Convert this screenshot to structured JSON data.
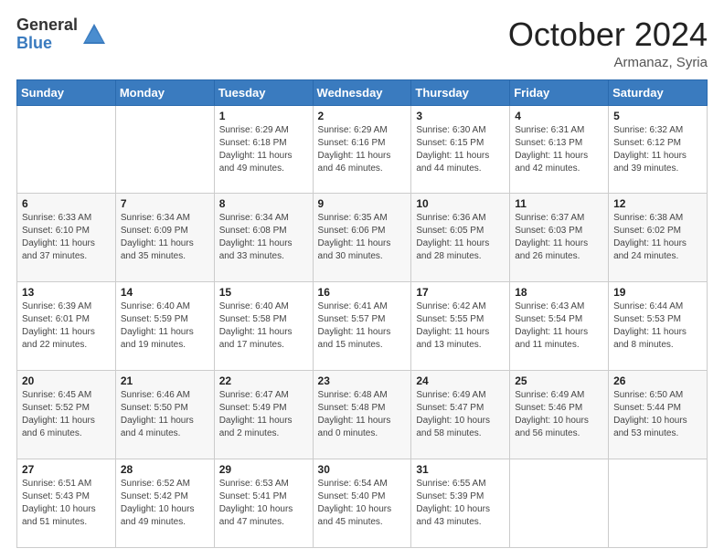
{
  "header": {
    "logo_general": "General",
    "logo_blue": "Blue",
    "month_title": "October 2024",
    "location": "Armanaz, Syria"
  },
  "weekdays": [
    "Sunday",
    "Monday",
    "Tuesday",
    "Wednesday",
    "Thursday",
    "Friday",
    "Saturday"
  ],
  "weeks": [
    [
      {
        "day": "",
        "detail": ""
      },
      {
        "day": "",
        "detail": ""
      },
      {
        "day": "1",
        "detail": "Sunrise: 6:29 AM\nSunset: 6:18 PM\nDaylight: 11 hours and 49 minutes."
      },
      {
        "day": "2",
        "detail": "Sunrise: 6:29 AM\nSunset: 6:16 PM\nDaylight: 11 hours and 46 minutes."
      },
      {
        "day": "3",
        "detail": "Sunrise: 6:30 AM\nSunset: 6:15 PM\nDaylight: 11 hours and 44 minutes."
      },
      {
        "day": "4",
        "detail": "Sunrise: 6:31 AM\nSunset: 6:13 PM\nDaylight: 11 hours and 42 minutes."
      },
      {
        "day": "5",
        "detail": "Sunrise: 6:32 AM\nSunset: 6:12 PM\nDaylight: 11 hours and 39 minutes."
      }
    ],
    [
      {
        "day": "6",
        "detail": "Sunrise: 6:33 AM\nSunset: 6:10 PM\nDaylight: 11 hours and 37 minutes."
      },
      {
        "day": "7",
        "detail": "Sunrise: 6:34 AM\nSunset: 6:09 PM\nDaylight: 11 hours and 35 minutes."
      },
      {
        "day": "8",
        "detail": "Sunrise: 6:34 AM\nSunset: 6:08 PM\nDaylight: 11 hours and 33 minutes."
      },
      {
        "day": "9",
        "detail": "Sunrise: 6:35 AM\nSunset: 6:06 PM\nDaylight: 11 hours and 30 minutes."
      },
      {
        "day": "10",
        "detail": "Sunrise: 6:36 AM\nSunset: 6:05 PM\nDaylight: 11 hours and 28 minutes."
      },
      {
        "day": "11",
        "detail": "Sunrise: 6:37 AM\nSunset: 6:03 PM\nDaylight: 11 hours and 26 minutes."
      },
      {
        "day": "12",
        "detail": "Sunrise: 6:38 AM\nSunset: 6:02 PM\nDaylight: 11 hours and 24 minutes."
      }
    ],
    [
      {
        "day": "13",
        "detail": "Sunrise: 6:39 AM\nSunset: 6:01 PM\nDaylight: 11 hours and 22 minutes."
      },
      {
        "day": "14",
        "detail": "Sunrise: 6:40 AM\nSunset: 5:59 PM\nDaylight: 11 hours and 19 minutes."
      },
      {
        "day": "15",
        "detail": "Sunrise: 6:40 AM\nSunset: 5:58 PM\nDaylight: 11 hours and 17 minutes."
      },
      {
        "day": "16",
        "detail": "Sunrise: 6:41 AM\nSunset: 5:57 PM\nDaylight: 11 hours and 15 minutes."
      },
      {
        "day": "17",
        "detail": "Sunrise: 6:42 AM\nSunset: 5:55 PM\nDaylight: 11 hours and 13 minutes."
      },
      {
        "day": "18",
        "detail": "Sunrise: 6:43 AM\nSunset: 5:54 PM\nDaylight: 11 hours and 11 minutes."
      },
      {
        "day": "19",
        "detail": "Sunrise: 6:44 AM\nSunset: 5:53 PM\nDaylight: 11 hours and 8 minutes."
      }
    ],
    [
      {
        "day": "20",
        "detail": "Sunrise: 6:45 AM\nSunset: 5:52 PM\nDaylight: 11 hours and 6 minutes."
      },
      {
        "day": "21",
        "detail": "Sunrise: 6:46 AM\nSunset: 5:50 PM\nDaylight: 11 hours and 4 minutes."
      },
      {
        "day": "22",
        "detail": "Sunrise: 6:47 AM\nSunset: 5:49 PM\nDaylight: 11 hours and 2 minutes."
      },
      {
        "day": "23",
        "detail": "Sunrise: 6:48 AM\nSunset: 5:48 PM\nDaylight: 11 hours and 0 minutes."
      },
      {
        "day": "24",
        "detail": "Sunrise: 6:49 AM\nSunset: 5:47 PM\nDaylight: 10 hours and 58 minutes."
      },
      {
        "day": "25",
        "detail": "Sunrise: 6:49 AM\nSunset: 5:46 PM\nDaylight: 10 hours and 56 minutes."
      },
      {
        "day": "26",
        "detail": "Sunrise: 6:50 AM\nSunset: 5:44 PM\nDaylight: 10 hours and 53 minutes."
      }
    ],
    [
      {
        "day": "27",
        "detail": "Sunrise: 6:51 AM\nSunset: 5:43 PM\nDaylight: 10 hours and 51 minutes."
      },
      {
        "day": "28",
        "detail": "Sunrise: 6:52 AM\nSunset: 5:42 PM\nDaylight: 10 hours and 49 minutes."
      },
      {
        "day": "29",
        "detail": "Sunrise: 6:53 AM\nSunset: 5:41 PM\nDaylight: 10 hours and 47 minutes."
      },
      {
        "day": "30",
        "detail": "Sunrise: 6:54 AM\nSunset: 5:40 PM\nDaylight: 10 hours and 45 minutes."
      },
      {
        "day": "31",
        "detail": "Sunrise: 6:55 AM\nSunset: 5:39 PM\nDaylight: 10 hours and 43 minutes."
      },
      {
        "day": "",
        "detail": ""
      },
      {
        "day": "",
        "detail": ""
      }
    ]
  ]
}
